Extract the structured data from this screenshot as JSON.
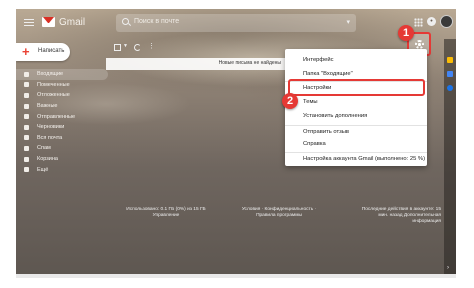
{
  "header": {
    "logo_text": "Gmail",
    "search_placeholder": "Поиск в почте"
  },
  "compose": {
    "label": "Написать"
  },
  "sidebar": {
    "items": [
      {
        "label": "Входящие"
      },
      {
        "label": "Помеченные"
      },
      {
        "label": "Отложенные"
      },
      {
        "label": "Важные"
      },
      {
        "label": "Отправленные"
      },
      {
        "label": "Черновики"
      },
      {
        "label": "Вся почта"
      },
      {
        "label": "Спам"
      },
      {
        "label": "Корзина"
      },
      {
        "label": "Ещё"
      }
    ]
  },
  "info_bar": {
    "text": "Новые письма не найдены"
  },
  "footer": {
    "usage": "Использовано: 0.1 ГБ (0%) из 15 ГБ Управление",
    "links": "Условия · Конфиденциальность · Правила программы",
    "activity": "Последние действия в аккаунте: 15 мин. назад Дополнительная информация"
  },
  "dropdown": {
    "items": [
      {
        "label": "Интерфейс"
      },
      {
        "label": "Папка \"Входящие\""
      },
      {
        "label": "Настройки"
      },
      {
        "label": "Темы"
      },
      {
        "label": "Установить дополнения"
      },
      {
        "label": "Отправить отзыв"
      },
      {
        "label": "Справка"
      },
      {
        "label": "Настройка аккаунта Gmail (выполнено: 25 %)"
      }
    ]
  },
  "steps": {
    "one": "1",
    "two": "2"
  },
  "icons": {
    "menu": "hamburger-menu-icon",
    "search": "search-icon",
    "apps": "apps-grid-icon",
    "notifications": "bell-icon",
    "settings": "gear-icon",
    "refresh": "refresh-icon",
    "more": "more-vert-icon"
  },
  "colors": {
    "accent_red": "#e53935",
    "gmail_red": "#d93025",
    "compose_plus": "#ea4335"
  }
}
